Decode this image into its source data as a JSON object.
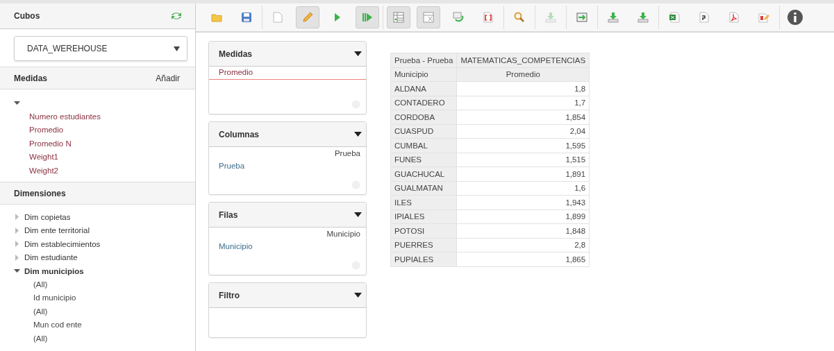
{
  "sidebar": {
    "title": "Cubos",
    "cube_select": {
      "value": "DATA_WEREHOUSE"
    },
    "measures": {
      "title": "Medidas",
      "action": "Añadir",
      "expanded": true,
      "items": [
        "Numero estudiantes",
        "Promedio",
        "Promedio N",
        "Weight1",
        "Weight2"
      ]
    },
    "dimensions": {
      "title": "Dimensiones",
      "items": [
        {
          "label": "Dim copietas",
          "expanded": false
        },
        {
          "label": "Dim ente territorial",
          "expanded": false
        },
        {
          "label": "Dim establecimientos",
          "expanded": false
        },
        {
          "label": "Dim estudiante",
          "expanded": false
        },
        {
          "label": "Dim municipios",
          "expanded": true,
          "children": [
            {
              "label": "(All)"
            },
            {
              "label": "Id municipio"
            },
            {
              "label": "(All)"
            },
            {
              "label": "Mun cod ente"
            },
            {
              "label": "(All)"
            }
          ]
        }
      ]
    }
  },
  "toolbar": [
    [
      {
        "kind": "folder",
        "pressed": false,
        "disabled": false
      },
      {
        "kind": "save",
        "pressed": false,
        "disabled": false
      }
    ],
    [
      {
        "kind": "new",
        "pressed": false,
        "disabled": false
      },
      {
        "kind": "pencil",
        "pressed": true,
        "disabled": false
      },
      {
        "kind": "play",
        "pressed": false,
        "disabled": false
      },
      {
        "kind": "run",
        "pressed": true,
        "disabled": false
      }
    ],
    [
      {
        "kind": "layout",
        "pressed": true,
        "disabled": false
      },
      {
        "kind": "hide",
        "pressed": true,
        "disabled": false
      },
      {
        "kind": "swap",
        "pressed": false,
        "disabled": false
      },
      {
        "kind": "mdx",
        "pressed": false,
        "disabled": false
      }
    ],
    [
      {
        "kind": "search",
        "pressed": false,
        "disabled": false
      }
    ],
    [
      {
        "kind": "download",
        "pressed": false,
        "disabled": true
      }
    ],
    [
      {
        "kind": "export",
        "pressed": false,
        "disabled": false
      }
    ],
    [
      {
        "kind": "download",
        "pressed": false,
        "disabled": false
      },
      {
        "kind": "download",
        "pressed": false,
        "disabled": false
      }
    ],
    [
      {
        "kind": "excel",
        "pressed": false,
        "disabled": false
      },
      {
        "kind": "csv",
        "pressed": false,
        "disabled": false
      },
      {
        "kind": "pdf",
        "pressed": false,
        "disabled": false
      },
      {
        "kind": "edit",
        "pressed": false,
        "disabled": false
      }
    ],
    [
      {
        "kind": "info",
        "pressed": false,
        "disabled": false
      }
    ]
  ],
  "drop_zones": [
    {
      "title": "Medidas",
      "items": [
        {
          "label": "Promedio",
          "kind": "measure"
        }
      ]
    },
    {
      "title": "Columnas",
      "items": [
        {
          "label": "Prueba",
          "kind": "hierarchy"
        },
        {
          "label": "Prueba",
          "kind": "level"
        }
      ]
    },
    {
      "title": "Filas",
      "items": [
        {
          "label": "Municipio",
          "kind": "hierarchy"
        },
        {
          "label": "Municipio",
          "kind": "level"
        }
      ]
    },
    {
      "title": "Filtro"
    }
  ],
  "table": {
    "header_rows": [
      [
        "Prueba - Prueba",
        "MATEMATICAS_COMPETENCIAS"
      ],
      [
        "Municipio",
        "Promedio"
      ]
    ],
    "rows": [
      [
        "ALDANA",
        "1,8"
      ],
      [
        "CONTADERO",
        "1,7"
      ],
      [
        "CORDOBA",
        "1,854"
      ],
      [
        "CUASPUD",
        "2,04"
      ],
      [
        "CUMBAL",
        "1,595"
      ],
      [
        "FUNES",
        "1,515"
      ],
      [
        "GUACHUCAL",
        "1,891"
      ],
      [
        "GUALMATAN",
        "1,6"
      ],
      [
        "ILES",
        "1,943"
      ],
      [
        "IPIALES",
        "1,899"
      ],
      [
        "POTOSI",
        "1,848"
      ],
      [
        "PUERRES",
        "2,8"
      ],
      [
        "PUPIALES",
        "1,865"
      ]
    ]
  }
}
